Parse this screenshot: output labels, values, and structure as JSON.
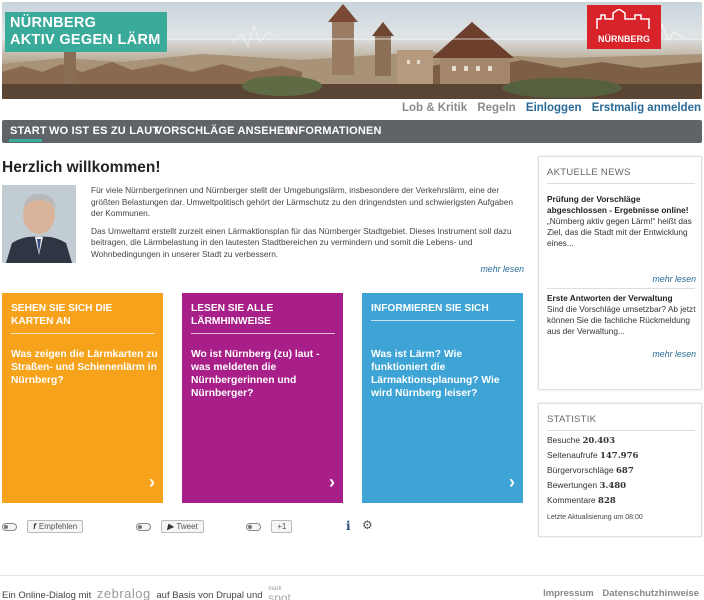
{
  "header": {
    "logo_line1": "NÜRNBERG",
    "logo_line2": "AKTIV GEGEN LÄRM",
    "brand_text": "NÜRNBERG"
  },
  "toplinks": [
    {
      "label": "Lob & Kritik",
      "style": "grey"
    },
    {
      "label": "Regeln",
      "style": "grey"
    },
    {
      "label": "Einloggen",
      "style": "blue"
    },
    {
      "label": "Erstmalig anmelden",
      "style": "blue"
    }
  ],
  "nav": {
    "items": [
      "START",
      "WO IST ES ZU LAUT",
      "VORSCHLÄGE ANSEHEN",
      "INFORMATIONEN"
    ],
    "active": "START"
  },
  "main": {
    "title": "Herzlich willkommen!",
    "paragraph1": "Für viele Nürnbergerinnen und Nürnberger stellt der Umgebungslärm, insbesondere der Verkehrslärm, eine der größten Belastungen dar. Umweltpolitisch gehört der Lärmschutz zu den dringendsten und schwierigsten Aufgaben der Kommunen.",
    "paragraph2": "Das Umweltamt erstellt zurzeit einen Lärmaktionsplan für das Nürnberger Stadtgebiet. Dieses Instrument soll dazu beitragen, die Lärmbelastung in den lautesten Stadtbereichen zu vermindern und somit die Lebens- und Wohnbedingungen in unserer Stadt zu verbessern.",
    "more_label": "mehr lesen"
  },
  "cards": [
    {
      "heading": "SEHEN SIE SICH DIE KARTEN AN",
      "question": "Was zeigen die Lärmkarten zu Straßen- und Schienenlärm in Nürnberg?",
      "color": "#f7a21b"
    },
    {
      "heading": "LESEN SIE ALLE LÄRMHINWEISE",
      "question": "Wo ist Nürnberg (zu) laut - was meldeten die Nürnbergerinnen und Nürnberger?",
      "color": "#a81f8a"
    },
    {
      "heading": "INFORMIEREN SIE SICH",
      "question": "Was ist Lärm? Wie funktioniert die Lärmaktionsplanung? Wie wird Nürnberg leiser?",
      "color": "#3da4d5"
    }
  ],
  "social": {
    "facebook_icon": "f",
    "facebook_label": "Empfehlen",
    "twitter_label": "Tweet",
    "gplus_label": "+1"
  },
  "sidebar": {
    "news_title": "AKTUELLE NEWS",
    "news": [
      {
        "headline": "Prüfung der Vorschläge abgeschlossen - Ergebnisse online!",
        "text": "„Nürnberg aktiv gegen Lärm!“ heißt das Ziel, das die Stadt mit der Entwicklung eines...",
        "more": "mehr lesen"
      },
      {
        "headline": "Erste Antworten der Verwaltung",
        "text": "Sind die Vorschläge umsetzbar? Ab jetzt können Sie die fachliche Rückmeldung aus der Verwaltung...",
        "more": "mehr lesen"
      }
    ],
    "stats_title": "STATISTIK",
    "stats": [
      {
        "label": "Besuche",
        "value": "20.403"
      },
      {
        "label": "Seitenaufrufe",
        "value": "147.976"
      },
      {
        "label": "Bürgervorschläge",
        "value": "687"
      },
      {
        "label": "Bewertungen",
        "value": "3.480"
      },
      {
        "label": "Kommentare",
        "value": "828"
      }
    ],
    "stats_updated": "Letzte Aktualisierung um 08:00"
  },
  "footer": {
    "prefix": "Ein Online-Dialog mit",
    "zebralog": "zebralog",
    "middle": "auf Basis von Drupal und",
    "markspot_small": "mark",
    "markspot_big": "spot",
    "links": [
      "Impressum",
      "Datenschutzhinweise"
    ]
  }
}
